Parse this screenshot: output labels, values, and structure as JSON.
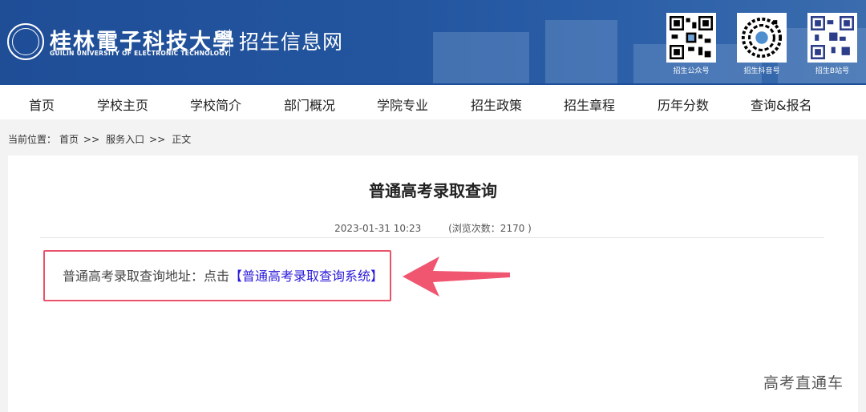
{
  "header": {
    "school_name_cn": "桂林電子科技大學",
    "school_name_en": "GUILIN UNIVERSITY OF ELECTRONIC TECHNOLOGY",
    "site_name": "招生信息网",
    "qr_codes": [
      {
        "label": "招生公众号"
      },
      {
        "label": "招生抖音号"
      },
      {
        "label": "招生B站号"
      }
    ]
  },
  "nav": {
    "items": [
      {
        "label": "首页"
      },
      {
        "label": "学校主页"
      },
      {
        "label": "学校简介"
      },
      {
        "label": "部门概况"
      },
      {
        "label": "学院专业"
      },
      {
        "label": "招生政策"
      },
      {
        "label": "招生章程"
      },
      {
        "label": "历年分数"
      },
      {
        "label": "查询&报名"
      }
    ]
  },
  "breadcrumb": {
    "prefix": "当前位置：",
    "items": [
      "首页",
      "服务入口",
      "正文"
    ],
    "separator": ">>"
  },
  "article": {
    "title": "普通高考录取查询",
    "date": "2023-01-31 10:23",
    "views_text": "(浏览次数：2170 )",
    "body_prefix": "普通高考录取查询地址：点击",
    "link_text": "【普通高考录取查询系统】"
  },
  "watermark": "高考直通车",
  "colors": {
    "header_bg": "#23559f",
    "highlight": "#e8536b",
    "link": "#2a1ad8"
  }
}
